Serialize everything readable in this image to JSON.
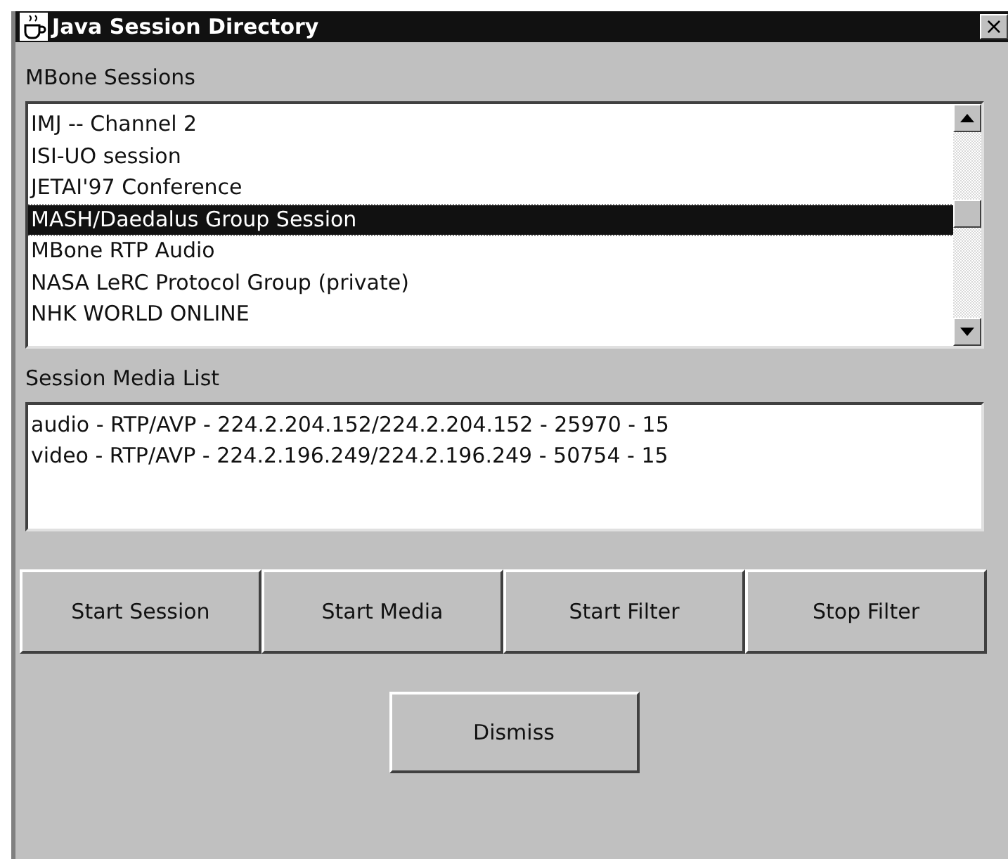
{
  "window": {
    "title": "Java Session Directory",
    "close": "×"
  },
  "sessions": {
    "label": "MBone Sessions",
    "items": [
      {
        "name": "IMJ -- Channel 2",
        "selected": false
      },
      {
        "name": "ISI-UO session",
        "selected": false
      },
      {
        "name": "JETAI'97 Conference",
        "selected": false
      },
      {
        "name": "MASH/Daedalus Group Session",
        "selected": true
      },
      {
        "name": "MBone RTP Audio",
        "selected": false
      },
      {
        "name": "NASA LeRC Protocol Group (private)",
        "selected": false
      },
      {
        "name": "NHK WORLD ONLINE",
        "selected": false
      }
    ]
  },
  "media": {
    "label": "Session Media List",
    "items": [
      "audio - RTP/AVP - 224.2.204.152/224.2.204.152 - 25970 - 15",
      "video - RTP/AVP - 224.2.196.249/224.2.196.249 - 50754 - 15"
    ]
  },
  "buttons": [
    "Start Session",
    "Start Media",
    "Start Filter",
    "Stop Filter"
  ],
  "dismiss": "Dismiss"
}
